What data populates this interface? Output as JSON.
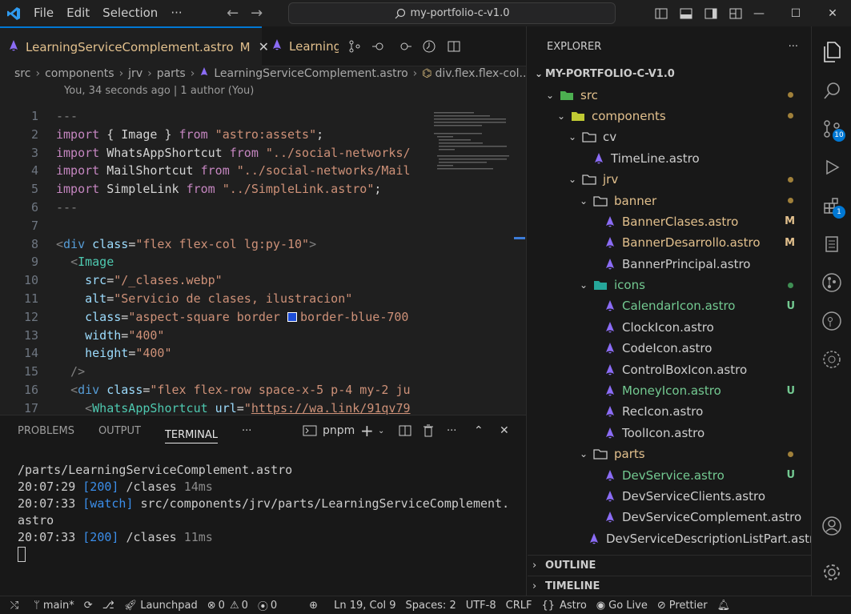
{
  "titlebar": {
    "menu": [
      "File",
      "Edit",
      "Selection",
      "···"
    ],
    "search": "my-portfolio-c-v1.0"
  },
  "tabs": {
    "active": {
      "label": "LearningServiceComplement.astro",
      "status": "M"
    },
    "second": {
      "label": "LearningS"
    }
  },
  "breadcrumb": [
    "src",
    "components",
    "jrv",
    "parts",
    "LearningServiceComplement.astro",
    "div.flex.flex-col..."
  ],
  "blame": "You, 34 seconds ago | 1 author (You)",
  "code": {
    "line_numbers": [
      "1",
      "2",
      "3",
      "4",
      "5",
      "6",
      "7",
      "8",
      "9",
      "10",
      "11",
      "12",
      "13",
      "14",
      "15",
      "16",
      "17"
    ],
    "current_line": "19",
    "lines": [
      "---",
      "import { Image } from \"astro:assets\";",
      "import WhatsAppShortcut from \"../social-networks/",
      "import MailShortcut from \"../social-networks/Mail",
      "import SimpleLink from \"../SimpleLink.astro\";",
      "---",
      "",
      "<div class=\"flex flex-col lg:py-10\">",
      "  <Image",
      "    src=\"/_clases.webp\"",
      "    alt=\"Servicio de clases, ilustracion\"",
      "    class=\"aspect-square border  border-blue-700",
      "    width=\"400\"",
      "    height=\"400\"",
      "  />",
      "  <div class=\"flex flex-row space-x-5 p-4 my-2 ju",
      "    <WhatsAppShortcut url=\"https://wa.link/91qv79"
    ]
  },
  "panel": {
    "tabs": [
      "PROBLEMS",
      "OUTPUT",
      "TERMINAL",
      "···"
    ],
    "active_tab": "TERMINAL",
    "shell": "pnpm",
    "terminal": [
      {
        "text": "/parts/LearningServiceComplement.astro"
      },
      {
        "time": "20:07:29",
        "code": "[200]",
        "path": "/clases",
        "ms": "14ms"
      },
      {
        "time": "20:07:33",
        "code": "[watch]",
        "path": "src/components/jrv/parts/LearningServiceComplement.",
        "ms": ""
      },
      {
        "text": "astro"
      },
      {
        "time": "20:07:33",
        "code": "[200]",
        "path": "/clases",
        "ms": "11ms"
      }
    ]
  },
  "explorer": {
    "title": "EXPLORER",
    "root": "MY-PORTFOLIO-C-V1.0",
    "items": [
      {
        "label": "src",
        "kind": "folder-open",
        "indent": 1,
        "state": "mod-dot"
      },
      {
        "label": "components",
        "kind": "folder-open",
        "indent": 2,
        "state": "mod-dot"
      },
      {
        "label": "cv",
        "kind": "folder-open",
        "indent": 3,
        "state": ""
      },
      {
        "label": "TimeLine.astro",
        "kind": "file",
        "indent": 4,
        "state": ""
      },
      {
        "label": "jrv",
        "kind": "folder-open",
        "indent": 3,
        "state": "mod-dot"
      },
      {
        "label": "banner",
        "kind": "folder-open",
        "indent": 4,
        "state": "mod-dot"
      },
      {
        "label": "BannerClases.astro",
        "kind": "file",
        "indent": 5,
        "state": "M"
      },
      {
        "label": "BannerDesarrollo.astro",
        "kind": "file",
        "indent": 5,
        "state": "M"
      },
      {
        "label": "BannerPrincipal.astro",
        "kind": "file",
        "indent": 5,
        "state": ""
      },
      {
        "label": "icons",
        "kind": "folder-open",
        "indent": 4,
        "state": "unt-dot"
      },
      {
        "label": "CalendarIcon.astro",
        "kind": "file",
        "indent": 5,
        "state": "U"
      },
      {
        "label": "ClockIcon.astro",
        "kind": "file",
        "indent": 5,
        "state": ""
      },
      {
        "label": "CodeIcon.astro",
        "kind": "file",
        "indent": 5,
        "state": ""
      },
      {
        "label": "ControlBoxIcon.astro",
        "kind": "file",
        "indent": 5,
        "state": ""
      },
      {
        "label": "MoneyIcon.astro",
        "kind": "file",
        "indent": 5,
        "state": "U"
      },
      {
        "label": "RecIcon.astro",
        "kind": "file",
        "indent": 5,
        "state": ""
      },
      {
        "label": "ToolIcon.astro",
        "kind": "file",
        "indent": 5,
        "state": ""
      },
      {
        "label": "parts",
        "kind": "folder-open",
        "indent": 4,
        "state": "mod-dot"
      },
      {
        "label": "DevService.astro",
        "kind": "file",
        "indent": 5,
        "state": "U"
      },
      {
        "label": "DevServiceClients.astro",
        "kind": "file",
        "indent": 5,
        "state": ""
      },
      {
        "label": "DevServiceComplement.astro",
        "kind": "file",
        "indent": 5,
        "state": ""
      },
      {
        "label": "DevServiceDescriptionListPart.astro",
        "kind": "file",
        "indent": 5,
        "state": ""
      }
    ],
    "outline": "OUTLINE",
    "timeline": "TIMELINE"
  },
  "activity": {
    "scm_count": "10",
    "extensions_count": "1"
  },
  "status": {
    "branch": "main*",
    "launchpad": "Launchpad",
    "errors": "0",
    "warnings": "0",
    "ports": "0",
    "position": "Ln 19, Col 9",
    "spaces": "Spaces: 2",
    "encoding": "UTF-8",
    "eol": "CRLF",
    "language": "Astro",
    "golive": "Go Live",
    "prettier": "Prettier"
  },
  "colors": {
    "accent": "#0078d4",
    "modified": "#e2c08d",
    "untracked": "#73c991",
    "astro": "#8b6cf6"
  }
}
